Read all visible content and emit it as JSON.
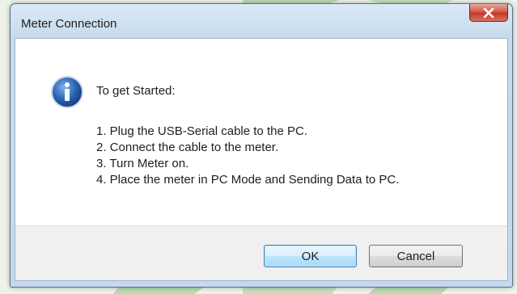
{
  "dialog": {
    "title": "Meter Connection",
    "close_icon": "close-icon",
    "heading": "To get Started:",
    "info_icon": "info-icon",
    "steps": [
      "1. Plug the USB-Serial cable to the PC.",
      "2. Connect the cable to the meter.",
      "3. Turn Meter on.",
      "4. Place the meter in PC Mode and Sending Data to PC."
    ],
    "buttons": {
      "ok_label": "OK",
      "cancel_label": "Cancel"
    }
  },
  "colors": {
    "background_accent": "#8fc48a",
    "close_button": "#c0392b",
    "default_button_border": "#3c7fb1",
    "info_icon": "#2a63b5"
  }
}
